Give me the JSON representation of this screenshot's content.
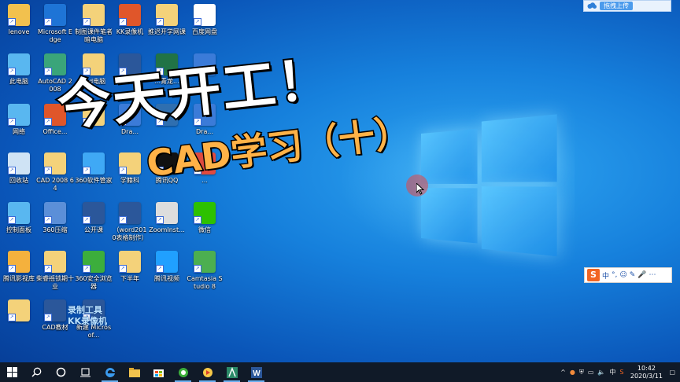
{
  "desktop": {
    "icons": [
      {
        "label": "lenove",
        "icon": "user-folder-icon",
        "color": "#f2c14e"
      },
      {
        "label": "Microsoft Edge",
        "icon": "edge-icon",
        "color": "#1e74d6"
      },
      {
        "label": "制图课件笔者暗电脑",
        "icon": "folder-doc-icon",
        "color": "#f4d27a"
      },
      {
        "label": "KK录像机",
        "icon": "kk-recorder-icon",
        "color": "#e0562a"
      },
      {
        "label": "推迟开学网课",
        "icon": "folder-doc-icon",
        "color": "#f4d27a"
      },
      {
        "label": "百度网盘",
        "icon": "baidu-netdisk-icon",
        "color": "#ffffff"
      },
      {
        "label": "此电脑",
        "icon": "computer-icon",
        "color": "#59b7f0"
      },
      {
        "label": "AutoCAD 2008",
        "icon": "autocad-icon",
        "color": "#3aa57a"
      },
      {
        "label": "cad电脑",
        "icon": "folder-doc-icon",
        "color": "#f4d27a"
      },
      {
        "label": "19...",
        "icon": "word-doc-icon",
        "color": "#2b579a"
      },
      {
        "label": "...青龙...",
        "icon": "excel-doc-icon",
        "color": "#217346"
      },
      {
        "label": "",
        "icon": "video-app-icon",
        "color": "#3b7bd8"
      },
      {
        "label": "网络",
        "icon": "network-icon",
        "color": "#59b7f0"
      },
      {
        "label": "Office...",
        "icon": "office-icon",
        "color": "#e0562a"
      },
      {
        "label": "",
        "icon": "folder-doc-icon",
        "color": "#f4d27a"
      },
      {
        "label": "Dra...",
        "icon": "dwg-icon",
        "color": "#3b7bd8"
      },
      {
        "label": "",
        "icon": "dwg-icon",
        "color": "#2f6fb0"
      },
      {
        "label": "Dra...",
        "icon": "dwg-icon",
        "color": "#3b7bd8"
      },
      {
        "label": "回收站",
        "icon": "recycle-bin-icon",
        "color": "#cfe3f5"
      },
      {
        "label": "CAD 2008 64",
        "icon": "folder-doc-icon",
        "color": "#f4d27a"
      },
      {
        "label": "360软件管家",
        "icon": "software-manager-icon",
        "color": "#3fa9f5"
      },
      {
        "label": "学籍科",
        "icon": "folder-doc-icon",
        "color": "#f4d27a"
      },
      {
        "label": "腾讯QQ",
        "icon": "qq-icon",
        "color": "#111111"
      },
      {
        "label": "...",
        "icon": "player-icon",
        "color": "#e04a3f"
      },
      {
        "label": "控制面板",
        "icon": "control-panel-icon",
        "color": "#59b7f0"
      },
      {
        "label": "360压缩",
        "icon": "archive-icon",
        "color": "#5b8fd8"
      },
      {
        "label": "公开课",
        "icon": "word-doc-icon",
        "color": "#2b579a"
      },
      {
        "label": "（word2010表格制作）",
        "icon": "word-doc-icon",
        "color": "#2b579a"
      },
      {
        "label": "ZoomInst...",
        "icon": "zoom-installer-icon",
        "color": "#dddddd"
      },
      {
        "label": "微信",
        "icon": "wechat-icon",
        "color": "#2dc100"
      },
      {
        "label": "腾讯影视库",
        "icon": "folder-video-icon",
        "color": "#f4b13d"
      },
      {
        "label": "柴睿摇锁期十业",
        "icon": "folder-doc-icon",
        "color": "#f4d27a"
      },
      {
        "label": "360安全浏览器",
        "icon": "360-browser-icon",
        "color": "#3cae3c"
      },
      {
        "label": "下半年",
        "icon": "folder-doc-icon",
        "color": "#f4d27a"
      },
      {
        "label": "腾讯视频",
        "icon": "tencent-video-icon",
        "color": "#20a0ff"
      },
      {
        "label": "Camtasia Studio 8",
        "icon": "camtasia-icon",
        "color": "#4caf50"
      },
      {
        "label": "",
        "icon": "folder-doc-icon",
        "color": "#f4d27a"
      },
      {
        "label": "CAD教材",
        "icon": "word-doc-icon",
        "color": "#2b579a"
      },
      {
        "label": "新建 Microsof...",
        "icon": "word-doc-icon",
        "color": "#2b579a"
      }
    ]
  },
  "overlay": {
    "title": "今天开工！",
    "subtitle": "CAD学习（十）"
  },
  "watermark": {
    "line1": "录制工具",
    "line2": "KK录像机"
  },
  "upload_widget": {
    "button": "拖拽上传"
  },
  "ime_bar": {
    "logo": "S",
    "mode": "中",
    "items": [
      "°,",
      "☺",
      "✎",
      "🎤",
      "⋯"
    ]
  },
  "taskbar": {
    "apps": [
      {
        "name": "start",
        "icon": "windows-start-icon"
      },
      {
        "name": "search",
        "icon": "search-icon"
      },
      {
        "name": "cortana",
        "icon": "cortana-icon"
      },
      {
        "name": "task-view",
        "icon": "task-view-icon"
      },
      {
        "name": "edge",
        "icon": "edge-icon"
      },
      {
        "name": "explorer",
        "icon": "file-explorer-icon"
      },
      {
        "name": "store",
        "icon": "store-icon"
      },
      {
        "name": "360-browser",
        "icon": "360-browser-icon"
      },
      {
        "name": "player",
        "icon": "player-icon"
      },
      {
        "name": "autocad",
        "icon": "autocad-icon"
      },
      {
        "name": "word",
        "icon": "word-icon"
      }
    ],
    "tray": {
      "ime": "中",
      "time": "10:42",
      "date": "2020/3/11"
    }
  },
  "colors": {
    "taskbar": "#101a28",
    "title_fill": "#ffffff",
    "subtitle_fill": "#ffb247",
    "accent": "#4c9bec"
  }
}
